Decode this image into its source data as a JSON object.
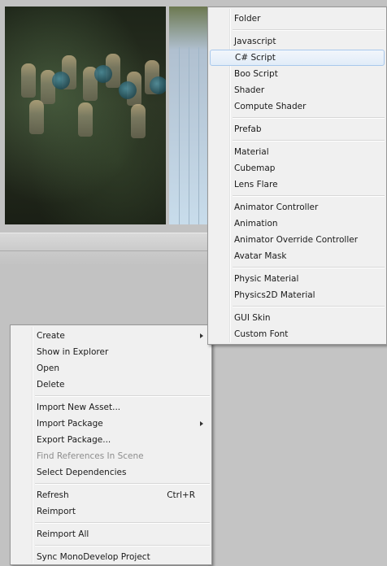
{
  "context_menu": {
    "items": [
      {
        "label": "Create",
        "submenu": true
      },
      {
        "label": "Show in Explorer"
      },
      {
        "label": "Open"
      },
      {
        "label": "Delete"
      },
      {
        "label": "Import New Asset..."
      },
      {
        "label": "Import Package",
        "submenu": true
      },
      {
        "label": "Export Package..."
      },
      {
        "label": "Find References In Scene",
        "disabled": true
      },
      {
        "label": "Select Dependencies"
      },
      {
        "label": "Refresh",
        "shortcut": "Ctrl+R"
      },
      {
        "label": "Reimport"
      },
      {
        "label": "Reimport All"
      },
      {
        "label": "Sync MonoDevelop Project"
      }
    ]
  },
  "create_submenu": {
    "items": [
      {
        "label": "Folder"
      },
      {
        "label": "Javascript"
      },
      {
        "label": "C# Script",
        "highlighted": true
      },
      {
        "label": "Boo Script"
      },
      {
        "label": "Shader"
      },
      {
        "label": "Compute Shader"
      },
      {
        "label": "Prefab"
      },
      {
        "label": "Material"
      },
      {
        "label": "Cubemap"
      },
      {
        "label": "Lens Flare"
      },
      {
        "label": "Animator Controller"
      },
      {
        "label": "Animation"
      },
      {
        "label": "Animator Override Controller"
      },
      {
        "label": "Avatar Mask"
      },
      {
        "label": "Physic Material"
      },
      {
        "label": "Physics2D Material"
      },
      {
        "label": "GUI Skin"
      },
      {
        "label": "Custom Font"
      }
    ]
  },
  "colors": {
    "menu_bg": "#f0f0f0",
    "highlight_border": "#a8c8ec",
    "panel_bg": "#c2c2c2"
  }
}
